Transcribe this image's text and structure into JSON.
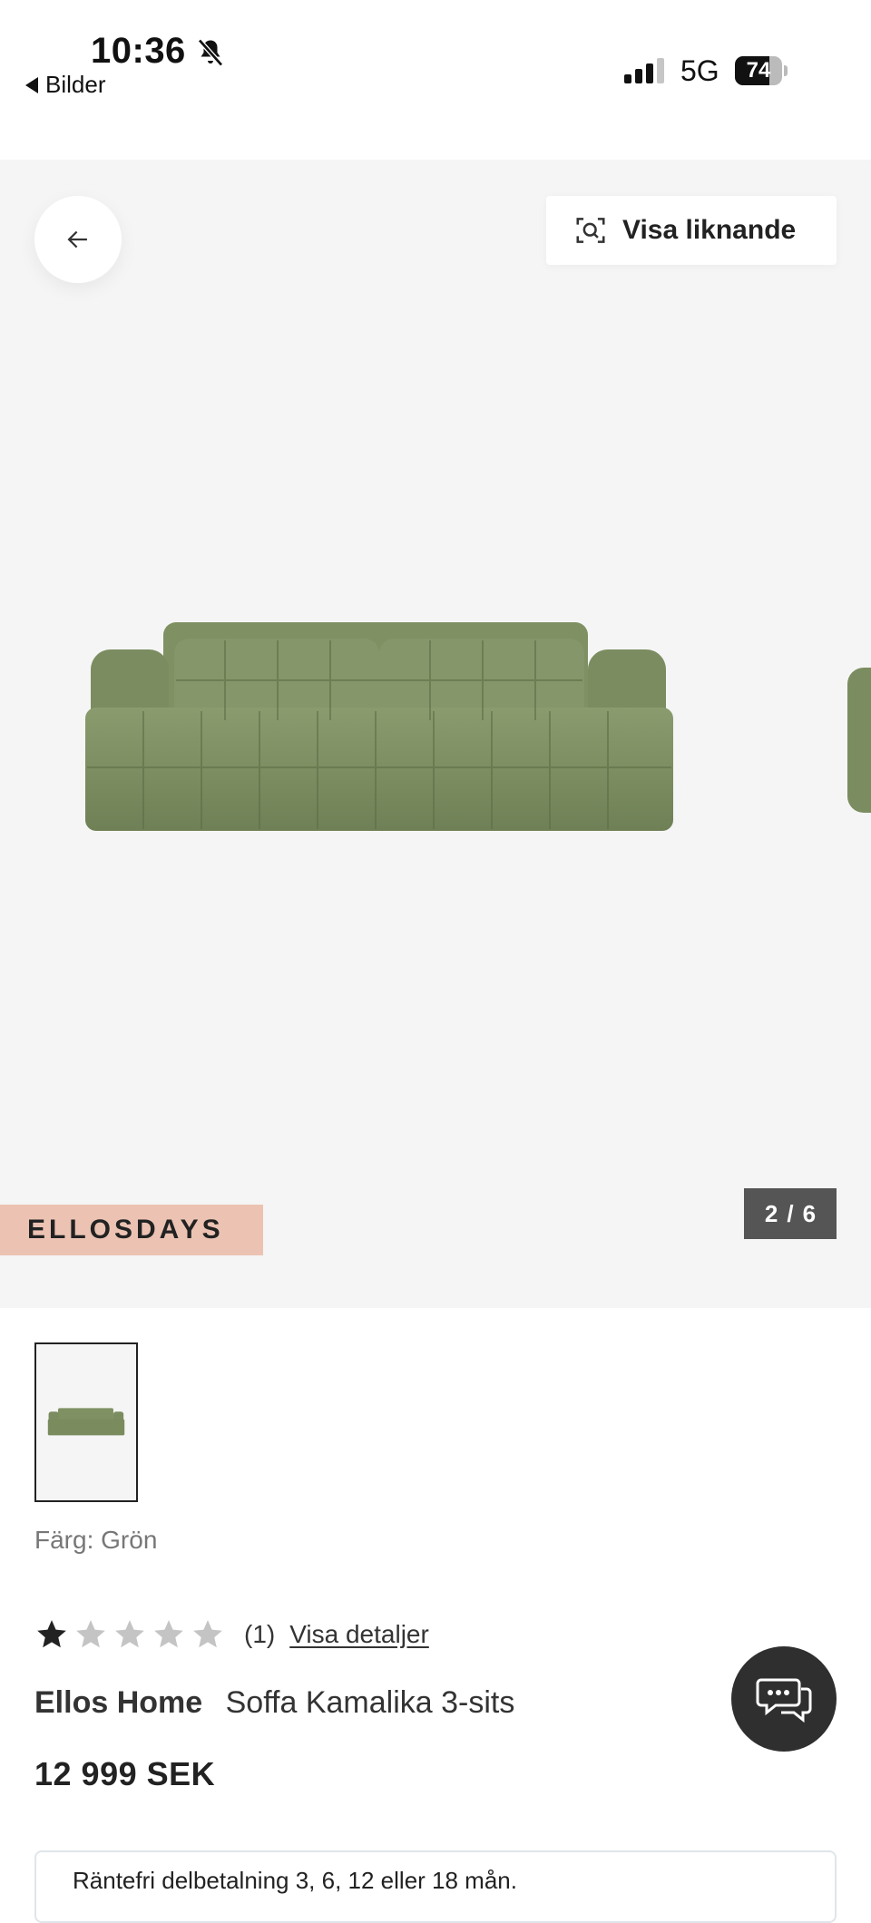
{
  "status_bar": {
    "time": "10:36",
    "back_app": "Bilder",
    "network": "5G",
    "battery_pct": "74",
    "battery_level": 0.74,
    "icons": [
      "bell-slash-icon",
      "cellular-signal-icon",
      "battery-icon"
    ]
  },
  "gallery": {
    "similar_button_label": "Visa liknande",
    "campaign_badge": "ELLOSDAYS",
    "counter": {
      "current": "2",
      "separator": "/",
      "total": "6"
    },
    "icons": [
      "arrow-left-icon",
      "visual-search-icon"
    ]
  },
  "product": {
    "color_label": "Färg:",
    "color_value": "Grön",
    "rating": 1,
    "rating_max": 5,
    "review_count": "(1)",
    "details_link": "Visa detaljer",
    "brand": "Ellos Home",
    "name": "Soffa Kamalika 3-sits",
    "price": "12 999 SEK"
  },
  "financing": {
    "text": "Räntefri delbetalning 3, 6, 12 eller 18 mån."
  },
  "colors": {
    "gallery_bg": "#f5f5f5",
    "campaign_bg": "#ecc3b3",
    "counter_bg": "#555555",
    "chat_bg": "#2f2f2f",
    "sofa_green": "#7d8f62"
  }
}
